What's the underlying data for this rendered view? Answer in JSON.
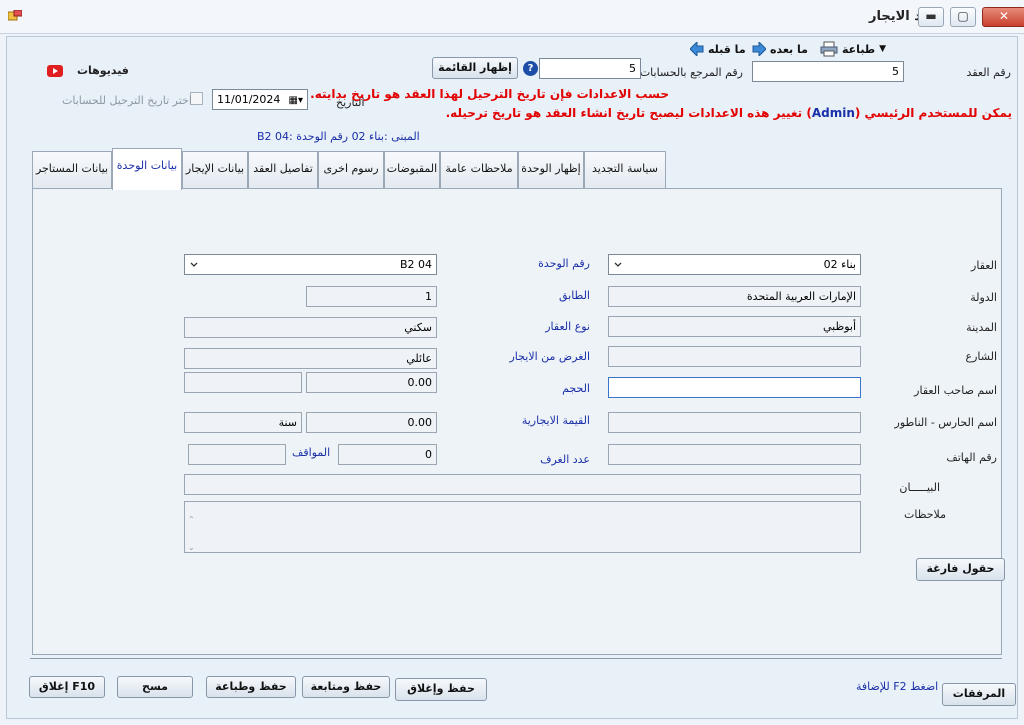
{
  "window": {
    "title": "عقد الايجار"
  },
  "toolbar": {
    "print": "طباعة",
    "next": "ما بعده",
    "prev": "ما قبله"
  },
  "videos": {
    "label": "فيديوهات"
  },
  "header": {
    "contract_no_label": "رقم العقد",
    "contract_no_value": "5",
    "ref_no_label": "رقم المرجع بالحسابات",
    "ref_no_value": "5",
    "help_glyph": "?",
    "show_list_button": "إظهار القائمة",
    "date_label": "التاريخ",
    "date_value": "11/01/2024",
    "posting_date_checkbox": "اختر تاريخ الترحيل للحسابات",
    "warning_line1": "حسب الاعدادات فإن تاريخ الترحيل لهذا العقد هو تاريخ بدايته.",
    "warning_line2_a": "يمكن للمستخدم الرئيسي (",
    "warning_line2_admin": "Admin",
    "warning_line2_b": ") تغيير هذه الاعدادات ليصبح تاريخ انشاء العقد هو تاريخ ترحيله.",
    "building_info": "المبنى :بناء 02 رقم الوحدة :B2 04"
  },
  "tabs": [
    {
      "label": "بيانات المستاجر"
    },
    {
      "label": "بيانات الوحدة"
    },
    {
      "label": "بيانات الإيجار"
    },
    {
      "label": "تفاصيل العقد"
    },
    {
      "label": "رسوم اخرى"
    },
    {
      "label": "المقبوضات"
    },
    {
      "label": "ملاحظات عامة"
    },
    {
      "label": "إظهار الوحدة"
    },
    {
      "label": "سياسة التجديد"
    }
  ],
  "form": {
    "property_label": "العقار",
    "property_value": "بناء 02",
    "country_label": "الدولة",
    "country_value": "الإمارات العربية المتحدة",
    "city_label": "المدينة",
    "city_value": "أبوظبي",
    "street_label": "الشارع",
    "street_value": "",
    "owner_label": "اسم صاحب العقار",
    "owner_value": "",
    "guard_label": "اسم الحارس - الناطور",
    "guard_value": "",
    "phone_label": "رقم الهاتف",
    "phone_value": "",
    "description_label": "البيـــــان",
    "description_value": "",
    "notes_label": "ملاحظات",
    "notes_value": "",
    "unit_no_label": "رقم الوحدة",
    "unit_no_value": "B2 04",
    "floor_label": "الطابق",
    "floor_value": "1",
    "property_type_label": "نوع العقار",
    "property_type_value": "سكني",
    "rent_purpose_label": "الغرض من الايجار",
    "rent_purpose_value": "عائلي",
    "size_label": "الحجم",
    "size_value": "0.00",
    "size_unit_value": "",
    "rent_value_label": "القيمة الايجارية",
    "rent_value": "0.00",
    "rent_period_value": "سنة",
    "rooms_label": "عدد الغرف",
    "rooms_value": "0",
    "parking_label": "المواقف",
    "parking_value": "",
    "empty_fields_button": "حقول فارغة"
  },
  "footer": {
    "attachments_button": "المرفقات",
    "f2_hint": "اضغط F2 للإضافة",
    "save_close": "حفظ وإغلاق",
    "save_continue": "حفظ ومتابعة",
    "save_print": "حفظ وطباعة",
    "clear": "مسح",
    "close_f10": "إغلاق F10"
  }
}
